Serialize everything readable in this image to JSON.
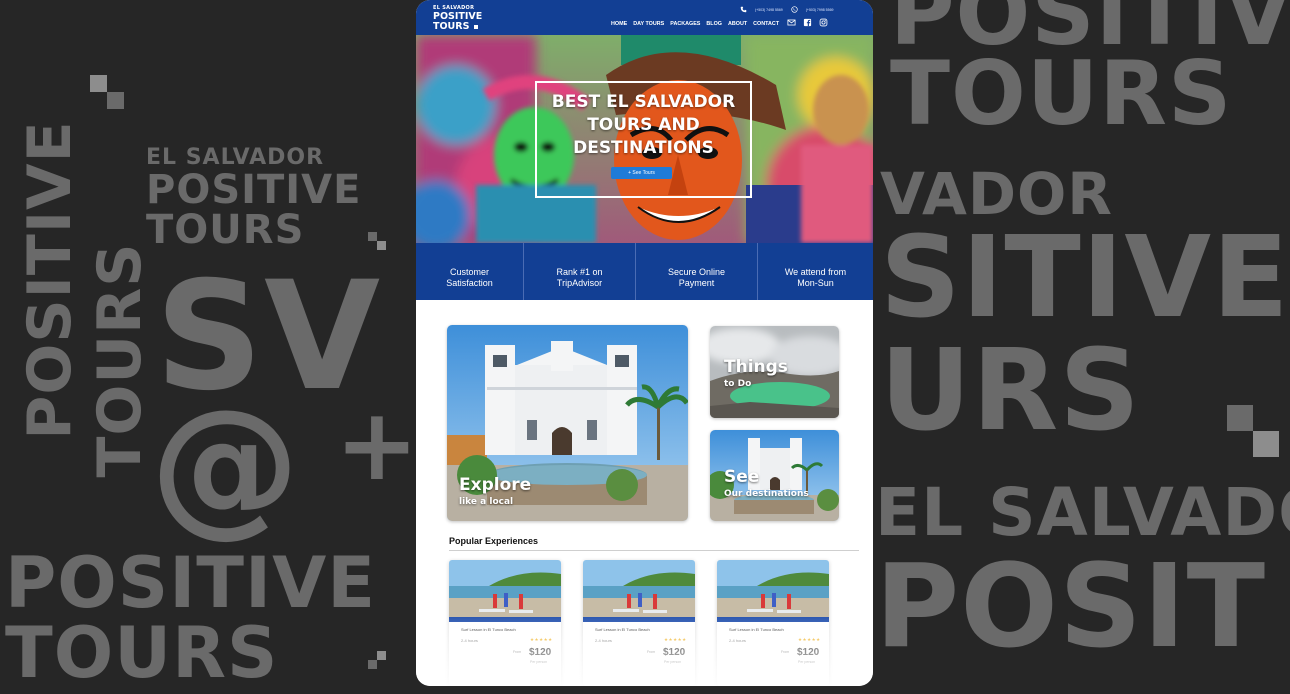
{
  "background": {
    "left_vertical_1": "POSITIVE",
    "left_vertical_2": "TOURS",
    "left_logo_line1": "EL SALVADOR",
    "left_logo_line2": "POSITIVE",
    "left_logo_line3": "TOURS",
    "left_sv": "SV",
    "left_at": "@",
    "left_plus": "+",
    "left_bottom_1": "POSITIVE",
    "left_bottom_2": "TOURS",
    "right_1": "POSITIVE",
    "right_2": "TOURS",
    "right_3": "VADOR",
    "right_4": "SITIVE",
    "right_5": "URS",
    "right_6": "EL SALVADOR",
    "right_7": "POSIT"
  },
  "header": {
    "logo_line1": "EL SALVADOR",
    "logo_line2": "POSITIVE",
    "logo_line3": "TOURS",
    "phone1": "(+503) 7498 5569",
    "phone2": "(+503) 7998 5569",
    "nav": [
      "HOME",
      "DAY TOURS",
      "PACKAGES",
      "BLOG",
      "ABOUT",
      "CONTACT"
    ]
  },
  "hero": {
    "title": "BEST EL SALVADOR TOURS AND DESTINATIONS",
    "button": "+ See Tours"
  },
  "features": [
    "Customer Satisfaction",
    "Rank #1 on TripAdvisor",
    "Secure Online Payment",
    "We attend from Mon-Sun"
  ],
  "cards": {
    "explore_title": "Explore",
    "explore_sub": "like a local",
    "things_title": "Things",
    "things_sub": "to Do",
    "see_title": "See",
    "see_sub": "Our destinations"
  },
  "popular": {
    "heading": "Popular Experiences",
    "items": [
      {
        "name": "Surf Lesson in El Tunco Beach",
        "duration": "2-4 hours",
        "stars": "★★★★★",
        "from": "From",
        "price": "$120",
        "per": "Per person"
      },
      {
        "name": "Surf Lesson in El Tunco Beach",
        "duration": "2-4 hours",
        "stars": "★★★★★",
        "from": "From",
        "price": "$120",
        "per": "Per person"
      },
      {
        "name": "Surf Lesson in El Tunco Beach",
        "duration": "2-4 hours",
        "stars": "★★★★★",
        "from": "From",
        "price": "$120",
        "per": "Per person"
      }
    ]
  },
  "colors": {
    "brand_blue": "#123f94",
    "button_blue": "#1f7bd8",
    "background": "#262626",
    "background_text": "#6a6a6a"
  }
}
